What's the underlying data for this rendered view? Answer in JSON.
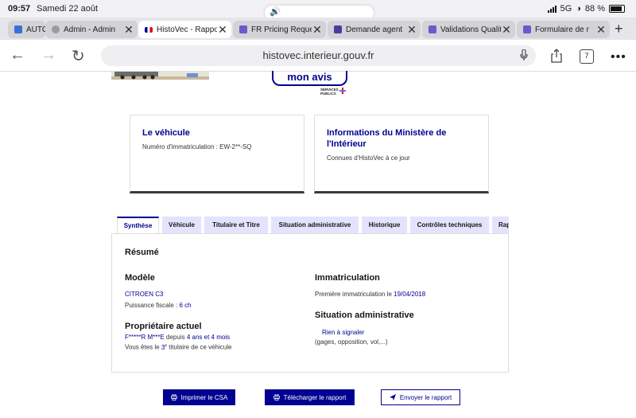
{
  "status_bar": {
    "time": "09:57",
    "date": "Samedi 22 août",
    "network": "5G",
    "battery": "88 %"
  },
  "browser": {
    "tabs": [
      {
        "title": "AUTO",
        "color": "#3a6fd8"
      },
      {
        "title": "Admin - Admin",
        "color": "#9a9aa0"
      },
      {
        "title": "HistoVec - Rapport",
        "color": "#000091"
      },
      {
        "title": "FR Pricing Request",
        "color": "#6a5acd"
      },
      {
        "title": "Demande agent",
        "color": "#4b3c9e"
      },
      {
        "title": "Validations Qualité",
        "color": "#6a5acd"
      },
      {
        "title": "Formulaire de r",
        "color": "#6a5acd"
      }
    ],
    "url": "histovec.interieur.gouv.fr",
    "tab_count": "7"
  },
  "page": {
    "avis_button": "mon avis",
    "services_publics": [
      "SERVICES",
      "PUBLICS"
    ],
    "card_vehicle": {
      "title": "Le véhicule",
      "subtitle": "Numéro d'immatriculation : EW-2**-SQ"
    },
    "card_ministry": {
      "title": "Informations du Ministère de l'Intérieur",
      "subtitle": "Connues d'HistoVec à ce jour"
    },
    "tabs": [
      "Synthèse",
      "Véhicule",
      "Titulaire et Titre",
      "Situation administrative",
      "Historique",
      "Contrôles techniques",
      "Rapport"
    ],
    "summary": {
      "title": "Résumé",
      "model_title": "Modèle",
      "model_value": "CITROEN C3",
      "power_label": "Puissance fiscale :",
      "power_value": "6 ch",
      "owner_title": "Propriétaire actuel",
      "owner_name": "F*****R M***E",
      "owner_since_label": "depuis",
      "owner_since_value": "4 ans et 4 mois",
      "holder_prefix": "Vous êtes le",
      "holder_rank": "3",
      "holder_rank_sup": "e",
      "holder_suffix": "titulaire de ce véhicule",
      "registration_title": "Immatriculation",
      "registration_label": "Première immatriculation le",
      "registration_date": "19/04/2018",
      "admin_title": "Situation administrative",
      "admin_value": "Rien à signaler",
      "admin_detail": "(gages, opposition, vol,...)"
    },
    "actions": {
      "print": "Imprimer le CSA",
      "download": "Télécharger le rapport",
      "send": "Envoyer le rapport"
    }
  }
}
